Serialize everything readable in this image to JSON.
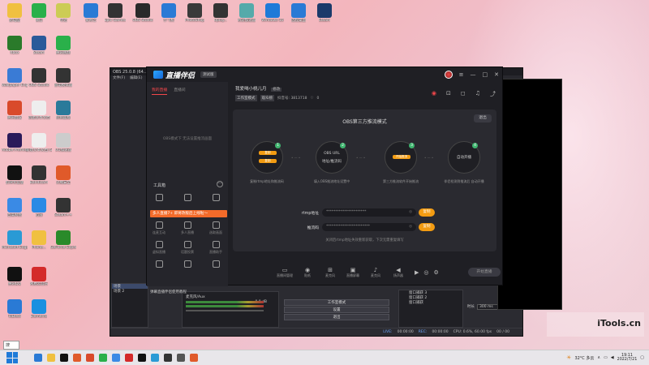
{
  "desktop_icons": [
    {
      "label": "此电脑",
      "color": "#f0c040"
    },
    {
      "label": "Xbox",
      "color": "#2a7a2a"
    },
    {
      "label": "Wallpaper Engine...",
      "color": "#3a7bd5"
    },
    {
      "label": "腾讯会议",
      "color": "#d94a2b"
    },
    {
      "label": "Adobe Premiere...",
      "color": "#2a1a5a"
    },
    {
      "label": "剪映专业版",
      "color": "#111"
    },
    {
      "label": "百度网盘",
      "color": "#3a8ae5"
    },
    {
      "label": "Microsoft Edge",
      "color": "#2a9ad5"
    },
    {
      "label": "腾讯QQ",
      "color": "#111"
    },
    {
      "label": "ToDesk",
      "color": "#2a7ad5"
    },
    {
      "label": "微信",
      "color": "#2ab04a"
    },
    {
      "label": "Steam",
      "color": "#2a5a9a"
    },
    {
      "label": "OBS Studio",
      "color": "#333"
    },
    {
      "label": "新建文本文档",
      "color": "#eee"
    },
    {
      "label": "新建文本文档 (2)",
      "color": "#eee"
    },
    {
      "label": "Bandicam",
      "color": "#333"
    },
    {
      "label": "迅雷",
      "color": "#2a8ae5"
    },
    {
      "label": "Phone...",
      "color": "#f0c040"
    },
    {
      "label": "网易云音乐",
      "color": "#d42a2a"
    },
    {
      "label": "Elements",
      "color": "#1a90e0"
    },
    {
      "label": "夸克",
      "color": "#cc5"
    },
    {
      "label": "腾讯视频",
      "color": "#2ab04a"
    },
    {
      "label": "雷电模拟器",
      "color": "#333"
    },
    {
      "label": "控制面板",
      "color": "#2a7a9a"
    },
    {
      "label": "UU加速器",
      "color": "#ccc"
    },
    {
      "label": "火绒安全",
      "color": "#e05a2a"
    },
    {
      "label": "Steam++",
      "color": "#333"
    },
    {
      "label": "GeForce Experience",
      "color": "#2a8a2a"
    },
    {
      "label": "爱奇艺",
      "color": "#2a7ad5"
    },
    {
      "label": "Epic Games",
      "color": "#333"
    },
    {
      "label": "OBS Studio",
      "color": "#2a2a2a"
    },
    {
      "label": "小飞机",
      "color": "#2a7ad5"
    },
    {
      "label": "PhotoShop",
      "color": "#3a3a3a"
    },
    {
      "label": "Uplay...",
      "color": "#333"
    },
    {
      "label": "奇游加速器",
      "color": "#5aa"
    },
    {
      "label": "Windows 10",
      "color": "#1e7ad8"
    },
    {
      "label": "远程桌面",
      "color": "#2a7ad5"
    },
    {
      "label": "Steam",
      "color": "#1a3a6a"
    }
  ],
  "obs": {
    "title": "OBS 25.0.8 (64...",
    "menu": [
      "文件(F)",
      "编辑(E)"
    ],
    "scenes": [
      "场景",
      "场景 2"
    ],
    "mixer_label": "麦克风/Aux",
    "mixer_db": "0.0 dB",
    "controls": [
      "工作室模式",
      "设置",
      "退出"
    ],
    "windows": [
      "窗口捕获 3",
      "窗口捕获 2",
      "窗口捕获"
    ],
    "props_label": "时长",
    "props_value": "300 ms",
    "status": {
      "live": "LIVE:",
      "live_time": "00:00:00",
      "rec": "REC:",
      "rec_time": "00:00:00",
      "cpu": "CPU: 0.6%, 60.00 fps",
      "counter": "00 / 00"
    }
  },
  "live": {
    "app_name": "直播伴侣",
    "version_badge": "测试版",
    "tabs": [
      "我的直播",
      "直播间"
    ],
    "empty_hint": "OBS模式下 无法设置推流画面",
    "toolbox_title": "工具箱",
    "tools": [
      "",
      "",
      "",
      "连麦互动",
      "多人直播",
      "选取画面",
      "虚拟直播",
      "话题投票",
      "直播助手",
      "",
      "",
      ""
    ],
    "promo_text": "多人直播7+ 即将改版后上线啦～",
    "notice": "弹幕直播伴侣使用教程",
    "room_title": "我爱喝小桃儿月",
    "room_edit": "修改",
    "room_tag1": "工作室模式",
    "room_tag2": "观众榜",
    "room_id": "抖音号: 3813718",
    "room_likes": "0",
    "card_title": "OBS第三方推流模式",
    "exit_label": "退出",
    "steps": [
      {
        "num": "1",
        "pill1": "复制",
        "pill2": "复制",
        "desc": "复制rtmp地址和推流码"
      },
      {
        "num": "2",
        "center1": "OBS URL",
        "center2": "地址/推流码",
        "desc": "填入OBS推流地址设置中"
      },
      {
        "num": "3",
        "pill": "开始推流",
        "desc": "第三方推流软件开始推流"
      },
      {
        "num": "4",
        "center1": "自动开播",
        "desc": "伴侣检测到推流后 自动开播"
      }
    ],
    "rtmp_label": "rtmp地址",
    "rtmp_value": "**********************",
    "key_label": "推流码",
    "key_value": "************************",
    "copy_label": "复制",
    "card_hint": "关闭后rtmp地址失效重新获取，下次无需重复填写",
    "bottom_items": [
      "直播间管理",
      "贴纸",
      "麦克风",
      "直播屏幕",
      "麦克风",
      "扬声器"
    ],
    "start_label": "开始直播"
  },
  "watermark": "iTools.cn",
  "taskbar": {
    "search": "搜",
    "weather": "32°C 多云",
    "time": "19:11",
    "date": "2022/7/21",
    "tooltip": "搜"
  }
}
